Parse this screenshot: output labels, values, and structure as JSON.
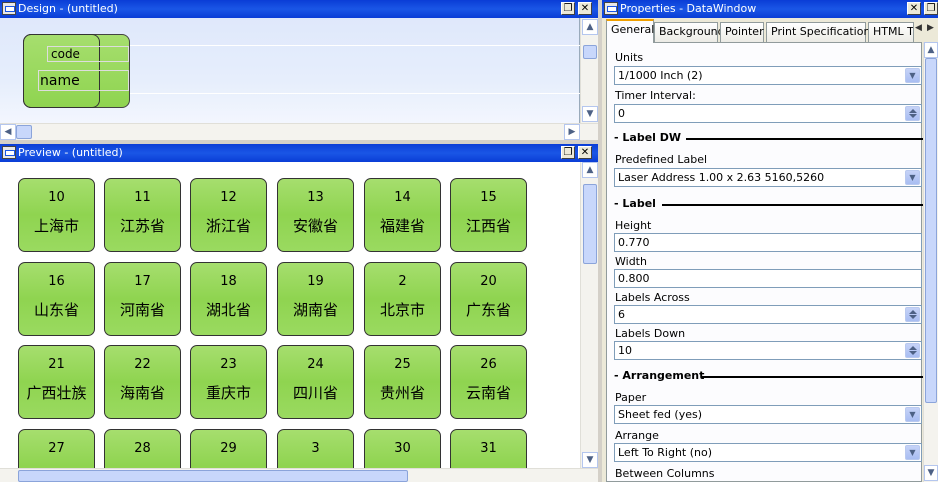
{
  "design": {
    "title": "Design - (untitled)",
    "fields": {
      "code": "code",
      "name": "name"
    }
  },
  "preview": {
    "title": "Preview - (untitled)",
    "cards": [
      {
        "code": "10",
        "name": "上海市"
      },
      {
        "code": "11",
        "name": "江苏省"
      },
      {
        "code": "12",
        "name": "浙江省"
      },
      {
        "code": "13",
        "name": "安徽省"
      },
      {
        "code": "14",
        "name": "福建省"
      },
      {
        "code": "15",
        "name": "江西省"
      },
      {
        "code": "16",
        "name": "山东省"
      },
      {
        "code": "17",
        "name": "河南省"
      },
      {
        "code": "18",
        "name": "湖北省"
      },
      {
        "code": "19",
        "name": "湖南省"
      },
      {
        "code": "2",
        "name": "北京市"
      },
      {
        "code": "20",
        "name": "广东省"
      },
      {
        "code": "21",
        "name": "广西壮族"
      },
      {
        "code": "22",
        "name": "海南省"
      },
      {
        "code": "23",
        "name": "重庆市"
      },
      {
        "code": "24",
        "name": "四川省"
      },
      {
        "code": "25",
        "name": "贵州省"
      },
      {
        "code": "26",
        "name": "云南省"
      },
      {
        "code": "27",
        "name": ""
      },
      {
        "code": "28",
        "name": ""
      },
      {
        "code": "29",
        "name": ""
      },
      {
        "code": "3",
        "name": ""
      },
      {
        "code": "30",
        "name": ""
      },
      {
        "code": "31",
        "name": ""
      }
    ]
  },
  "properties": {
    "title": "Properties - DataWindow",
    "tabs": [
      "General",
      "Background",
      "Pointer",
      "Print Specifications",
      "HTML T"
    ],
    "units_label": "Units",
    "units_value": "1/1000 Inch (2)",
    "timer_label": "Timer Interval:",
    "timer_value": "0",
    "section_label_dw": "Label DW",
    "predefined_label": "Predefined Label",
    "predefined_value": "Laser Address 1.00 x 2.63 5160,5260",
    "section_label": "Label",
    "height_label": "Height",
    "height_value": "0.770",
    "width_label": "Width",
    "width_value": "0.800",
    "across_label": "Labels Across",
    "across_value": "6",
    "down_label": "Labels Down",
    "down_value": "10",
    "section_arrangement": "Arrangement",
    "paper_label": "Paper",
    "paper_value": "Sheet fed (yes)",
    "arrange_label": "Arrange",
    "arrange_value": "Left To Right (no)",
    "between_label": "Between Columns"
  }
}
